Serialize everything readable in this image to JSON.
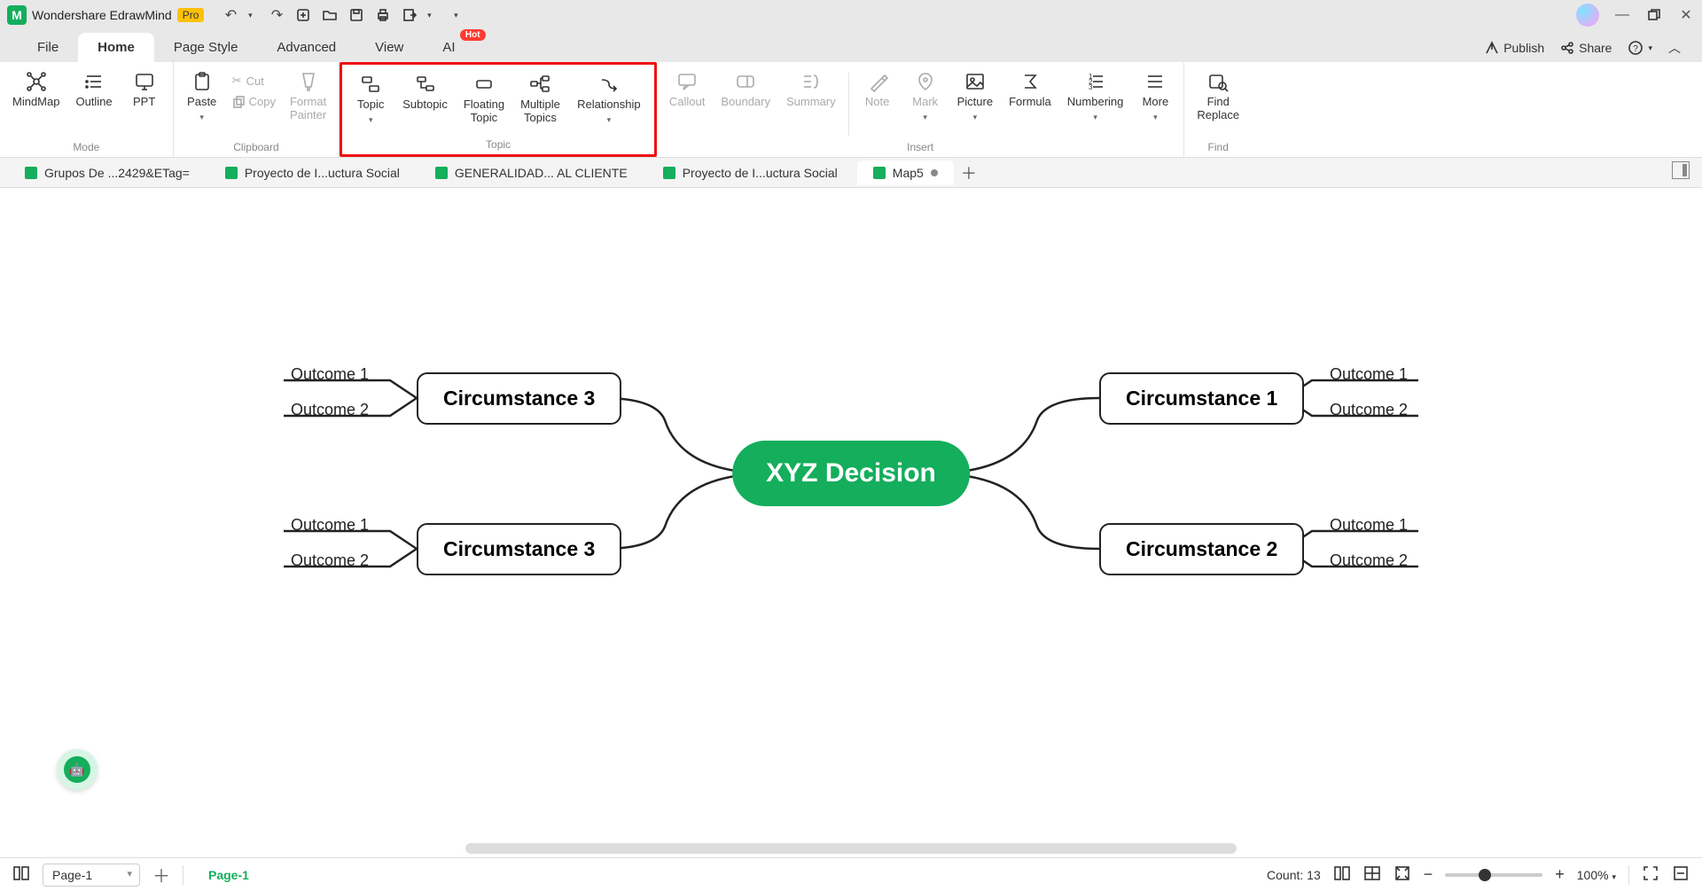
{
  "title": {
    "app": "Wondershare EdrawMind",
    "badge": "Pro"
  },
  "menu": {
    "tabs": [
      "File",
      "Home",
      "Page Style",
      "Advanced",
      "View",
      "AI"
    ],
    "hot": "Hot",
    "active": 1,
    "publish": "Publish",
    "share": "Share"
  },
  "ribbon": {
    "mode": {
      "label": "Mode",
      "mindmap": "MindMap",
      "outline": "Outline",
      "ppt": "PPT"
    },
    "clipboard": {
      "label": "Clipboard",
      "paste": "Paste",
      "cut": "Cut",
      "copy": "Copy",
      "format_painter": "Format\nPainter"
    },
    "topic": {
      "label": "Topic",
      "topic": "Topic",
      "subtopic": "Subtopic",
      "floating": "Floating\nTopic",
      "multiple": "Multiple\nTopics",
      "relationship": "Relationship"
    },
    "insert": {
      "label": "Insert",
      "callout": "Callout",
      "boundary": "Boundary",
      "summary": "Summary",
      "note": "Note",
      "mark": "Mark",
      "picture": "Picture",
      "formula": "Formula",
      "numbering": "Numbering",
      "more": "More"
    },
    "find": {
      "label": "Find",
      "find_replace": "Find\nReplace"
    }
  },
  "docs": {
    "tabs": [
      {
        "label": "Grupos De ...2429&ETag="
      },
      {
        "label": "Proyecto de I...uctura Social"
      },
      {
        "label": "GENERALIDAD... AL CLIENTE"
      },
      {
        "label": "Proyecto de I...uctura Social"
      },
      {
        "label": "Map5",
        "active": true,
        "dirty": true
      }
    ]
  },
  "mindmap": {
    "central": "XYZ Decision",
    "left": [
      {
        "title": "Circumstance 3",
        "outcomes": [
          "Outcome 1",
          "Outcome 2"
        ]
      },
      {
        "title": "Circumstance 3",
        "outcomes": [
          "Outcome 1",
          "Outcome 2"
        ]
      }
    ],
    "right": [
      {
        "title": "Circumstance 1",
        "outcomes": [
          "Outcome 1",
          "Outcome 2"
        ]
      },
      {
        "title": "Circumstance 2",
        "outcomes": [
          "Outcome 1",
          "Outcome 2"
        ]
      }
    ]
  },
  "status": {
    "page_select": "Page-1",
    "page_tab": "Page-1",
    "count": "Count: 13",
    "zoom": "100%"
  }
}
